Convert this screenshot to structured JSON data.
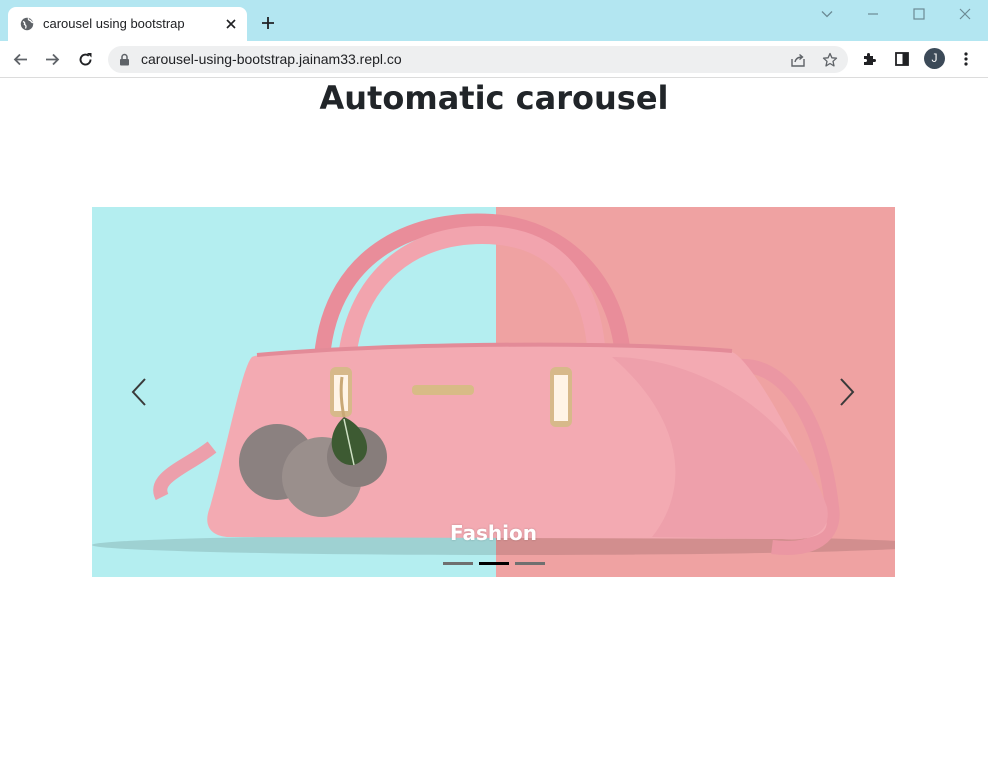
{
  "browser": {
    "tab_title": "carousel using bootstrap",
    "url": "carousel-using-bootstrap.jainam33.repl.co",
    "avatar_letter": "J",
    "colors": {
      "tabstrip": "#b3e6f1",
      "avatar": "#3c4a58"
    }
  },
  "page": {
    "title": "Automatic carousel"
  },
  "carousel": {
    "caption": "Fashion",
    "slides": 3,
    "active_slide": 2,
    "prev_icon": "chevron-left-icon",
    "next_icon": "chevron-right-icon",
    "colors": {
      "left_bg": "#b4eef0",
      "right_bg": "#efa2a2",
      "bag": "#f3aab2"
    }
  }
}
